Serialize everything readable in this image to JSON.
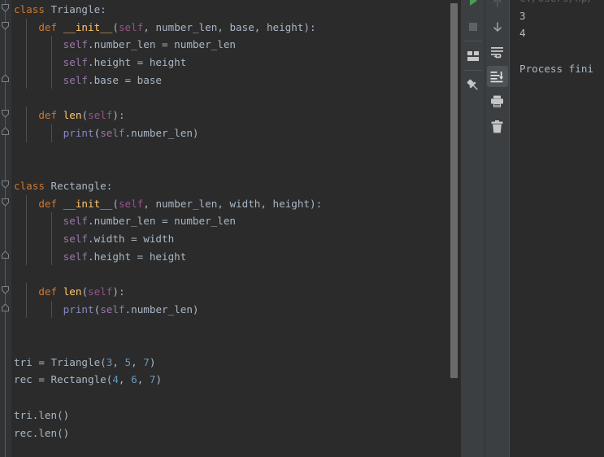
{
  "app": {
    "theme_bg": "#2b2b2b",
    "panel_bg": "#3c3f41",
    "accent_run": "#499c54"
  },
  "editor": {
    "language": "Python",
    "lines": [
      {
        "n": 1,
        "indent": 0,
        "tokens": [
          {
            "t": "class ",
            "c": "kw"
          },
          {
            "t": "Triangle:",
            "c": "pln"
          }
        ]
      },
      {
        "n": 2,
        "indent": 1,
        "tokens": [
          {
            "t": "    ",
            "c": "pln"
          },
          {
            "t": "def ",
            "c": "kw"
          },
          {
            "t": "__init__",
            "c": "fn"
          },
          {
            "t": "(",
            "c": "pln"
          },
          {
            "t": "self",
            "c": "slf"
          },
          {
            "t": ", number_len, base, height):",
            "c": "pln"
          }
        ]
      },
      {
        "n": 3,
        "indent": 2,
        "tokens": [
          {
            "t": "        ",
            "c": "pln"
          },
          {
            "t": "self",
            "c": "slfv"
          },
          {
            "t": ".number_len = number_len",
            "c": "pln"
          }
        ]
      },
      {
        "n": 4,
        "indent": 2,
        "tokens": [
          {
            "t": "        ",
            "c": "pln"
          },
          {
            "t": "self",
            "c": "slfv"
          },
          {
            "t": ".height = height",
            "c": "pln"
          }
        ]
      },
      {
        "n": 5,
        "indent": 2,
        "tokens": [
          {
            "t": "        ",
            "c": "pln"
          },
          {
            "t": "self",
            "c": "slfv"
          },
          {
            "t": ".base = base",
            "c": "pln"
          }
        ]
      },
      {
        "n": 6,
        "indent": 0,
        "tokens": []
      },
      {
        "n": 7,
        "indent": 1,
        "tokens": [
          {
            "t": "    ",
            "c": "pln"
          },
          {
            "t": "def ",
            "c": "kw"
          },
          {
            "t": "len",
            "c": "fn"
          },
          {
            "t": "(",
            "c": "pln"
          },
          {
            "t": "self",
            "c": "slf"
          },
          {
            "t": "):",
            "c": "pln"
          }
        ]
      },
      {
        "n": 8,
        "indent": 2,
        "tokens": [
          {
            "t": "        ",
            "c": "pln"
          },
          {
            "t": "print",
            "c": "bi"
          },
          {
            "t": "(",
            "c": "pln"
          },
          {
            "t": "self",
            "c": "slfv"
          },
          {
            "t": ".number_len)",
            "c": "pln"
          }
        ]
      },
      {
        "n": 9,
        "indent": 0,
        "tokens": []
      },
      {
        "n": 10,
        "indent": 0,
        "tokens": []
      },
      {
        "n": 11,
        "indent": 0,
        "tokens": [
          {
            "t": "class ",
            "c": "kw"
          },
          {
            "t": "Rectangle:",
            "c": "pln"
          }
        ]
      },
      {
        "n": 12,
        "indent": 1,
        "tokens": [
          {
            "t": "    ",
            "c": "pln"
          },
          {
            "t": "def ",
            "c": "kw"
          },
          {
            "t": "__init__",
            "c": "fn"
          },
          {
            "t": "(",
            "c": "pln"
          },
          {
            "t": "self",
            "c": "slf"
          },
          {
            "t": ", number_len, width, height):",
            "c": "pln"
          }
        ]
      },
      {
        "n": 13,
        "indent": 2,
        "tokens": [
          {
            "t": "        ",
            "c": "pln"
          },
          {
            "t": "self",
            "c": "slfv"
          },
          {
            "t": ".number_len = number_len",
            "c": "pln"
          }
        ]
      },
      {
        "n": 14,
        "indent": 2,
        "tokens": [
          {
            "t": "        ",
            "c": "pln"
          },
          {
            "t": "self",
            "c": "slfv"
          },
          {
            "t": ".width = width",
            "c": "pln"
          }
        ]
      },
      {
        "n": 15,
        "indent": 2,
        "tokens": [
          {
            "t": "        ",
            "c": "pln"
          },
          {
            "t": "self",
            "c": "slfv"
          },
          {
            "t": ".height = height",
            "c": "pln"
          }
        ]
      },
      {
        "n": 16,
        "indent": 0,
        "tokens": []
      },
      {
        "n": 17,
        "indent": 1,
        "tokens": [
          {
            "t": "    ",
            "c": "pln"
          },
          {
            "t": "def ",
            "c": "kw"
          },
          {
            "t": "len",
            "c": "fn"
          },
          {
            "t": "(",
            "c": "pln"
          },
          {
            "t": "self",
            "c": "slf"
          },
          {
            "t": "):",
            "c": "pln"
          }
        ]
      },
      {
        "n": 18,
        "indent": 2,
        "tokens": [
          {
            "t": "        ",
            "c": "pln"
          },
          {
            "t": "print",
            "c": "bi"
          },
          {
            "t": "(",
            "c": "pln"
          },
          {
            "t": "self",
            "c": "slfv"
          },
          {
            "t": ".number_len)",
            "c": "pln"
          }
        ]
      },
      {
        "n": 19,
        "indent": 0,
        "tokens": []
      },
      {
        "n": 20,
        "indent": 0,
        "tokens": []
      },
      {
        "n": 21,
        "indent": 0,
        "tokens": [
          {
            "t": "tri = Triangle(",
            "c": "pln"
          },
          {
            "t": "3",
            "c": "num"
          },
          {
            "t": ", ",
            "c": "pln"
          },
          {
            "t": "5",
            "c": "num"
          },
          {
            "t": ", ",
            "c": "pln"
          },
          {
            "t": "7",
            "c": "num"
          },
          {
            "t": ")",
            "c": "pln"
          }
        ]
      },
      {
        "n": 22,
        "indent": 0,
        "tokens": [
          {
            "t": "rec = Rectangle(",
            "c": "pln"
          },
          {
            "t": "4",
            "c": "num"
          },
          {
            "t": ", ",
            "c": "pln"
          },
          {
            "t": "6",
            "c": "num"
          },
          {
            "t": ", ",
            "c": "pln"
          },
          {
            "t": "7",
            "c": "num"
          },
          {
            "t": ")",
            "c": "pln"
          }
        ]
      },
      {
        "n": 23,
        "indent": 0,
        "tokens": []
      },
      {
        "n": 24,
        "indent": 0,
        "tokens": [
          {
            "t": "tri.len()",
            "c": "pln"
          }
        ]
      },
      {
        "n": 25,
        "indent": 0,
        "tokens": [
          {
            "t": "rec.len()",
            "c": "pln"
          }
        ]
      }
    ],
    "fold_markers": [
      {
        "line": 1,
        "type": "expanded"
      },
      {
        "line": 2,
        "type": "expanded"
      },
      {
        "line": 5,
        "type": "collapse-end"
      },
      {
        "line": 7,
        "type": "expanded"
      },
      {
        "line": 8,
        "type": "collapse-end"
      },
      {
        "line": 11,
        "type": "expanded"
      },
      {
        "line": 12,
        "type": "expanded"
      },
      {
        "line": 15,
        "type": "collapse-end"
      },
      {
        "line": 17,
        "type": "expanded"
      },
      {
        "line": 18,
        "type": "collapse-end"
      }
    ],
    "scrollbar": {
      "name": "editor-vertical-scrollbar"
    }
  },
  "run_toolbar": {
    "buttons": [
      {
        "id": "rerun",
        "icon": "play-icon",
        "label": "Rerun",
        "state": "enabled"
      },
      {
        "id": "stop",
        "icon": "stop-icon",
        "label": "Stop",
        "state": "disabled"
      },
      {
        "id": "layout",
        "icon": "layout-icon",
        "label": "Layout",
        "state": "enabled"
      },
      {
        "id": "pin",
        "icon": "pin-icon",
        "label": "Pin Tab",
        "state": "enabled"
      }
    ]
  },
  "console_toolbar": {
    "buttons": [
      {
        "id": "up",
        "icon": "arrow-up-icon",
        "label": "Up the Stack Trace",
        "state": "disabled"
      },
      {
        "id": "down",
        "icon": "arrow-down-icon",
        "label": "Down the Stack Trace",
        "state": "enabled"
      },
      {
        "id": "soft-wrap",
        "icon": "soft-wrap-icon",
        "label": "Use Soft Wraps",
        "state": "enabled"
      },
      {
        "id": "scroll-end",
        "icon": "scroll-to-end-icon",
        "label": "Scroll to the End",
        "state": "active"
      },
      {
        "id": "print",
        "icon": "printer-icon",
        "label": "Print",
        "state": "enabled"
      },
      {
        "id": "clear-all",
        "icon": "trash-icon",
        "label": "Clear All",
        "state": "enabled"
      }
    ]
  },
  "console": {
    "name": "run-output-console",
    "lines": [
      {
        "text": "C:/Users/hp/",
        "kind": "path"
      },
      {
        "text": "3",
        "kind": "out"
      },
      {
        "text": "4",
        "kind": "out"
      },
      {
        "text": "",
        "kind": "out"
      },
      {
        "text": "Process fini",
        "kind": "fin"
      }
    ]
  }
}
